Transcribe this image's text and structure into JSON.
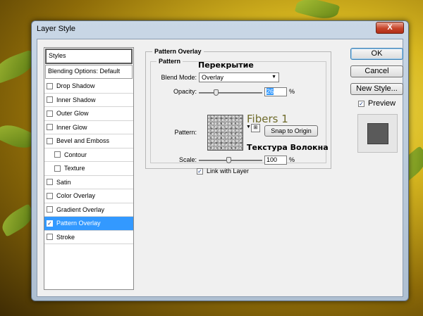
{
  "dialog": {
    "title": "Layer Style",
    "close_label": "X"
  },
  "styles_panel": {
    "header": "Styles",
    "blending_options": "Blending Options: Default",
    "items": [
      {
        "label": "Drop Shadow",
        "checked": false,
        "sub": false,
        "selected": false
      },
      {
        "label": "Inner Shadow",
        "checked": false,
        "sub": false,
        "selected": false
      },
      {
        "label": "Outer Glow",
        "checked": false,
        "sub": false,
        "selected": false
      },
      {
        "label": "Inner Glow",
        "checked": false,
        "sub": false,
        "selected": false
      },
      {
        "label": "Bevel and Emboss",
        "checked": false,
        "sub": false,
        "selected": false
      },
      {
        "label": "Contour",
        "checked": false,
        "sub": true,
        "selected": false
      },
      {
        "label": "Texture",
        "checked": false,
        "sub": true,
        "selected": false
      },
      {
        "label": "Satin",
        "checked": false,
        "sub": false,
        "selected": false
      },
      {
        "label": "Color Overlay",
        "checked": false,
        "sub": false,
        "selected": false
      },
      {
        "label": "Gradient Overlay",
        "checked": false,
        "sub": false,
        "selected": false
      },
      {
        "label": "Pattern Overlay",
        "checked": true,
        "sub": false,
        "selected": true
      },
      {
        "label": "Stroke",
        "checked": false,
        "sub": false,
        "selected": false
      }
    ]
  },
  "pattern_overlay": {
    "group_title": "Pattern Overlay",
    "inner_title": "Pattern",
    "blend_mode_label": "Blend Mode:",
    "blend_mode_value": "Overlay",
    "opacity_label": "Opacity:",
    "opacity_value": "26",
    "opacity_unit": "%",
    "pattern_label": "Pattern:",
    "snap_button": "Snap to Origin",
    "scale_label": "Scale:",
    "scale_value": "100",
    "scale_unit": "%",
    "link_label": "Link with Layer",
    "link_checked": true
  },
  "annotations": {
    "blend_ru": "Перекрытие",
    "pattern_name": "Fibers 1",
    "pattern_ru": "Текстура Волокна"
  },
  "buttons": {
    "ok": "OK",
    "cancel": "Cancel",
    "new_style": "New Style...",
    "preview_label": "Preview",
    "preview_checked": true
  }
}
